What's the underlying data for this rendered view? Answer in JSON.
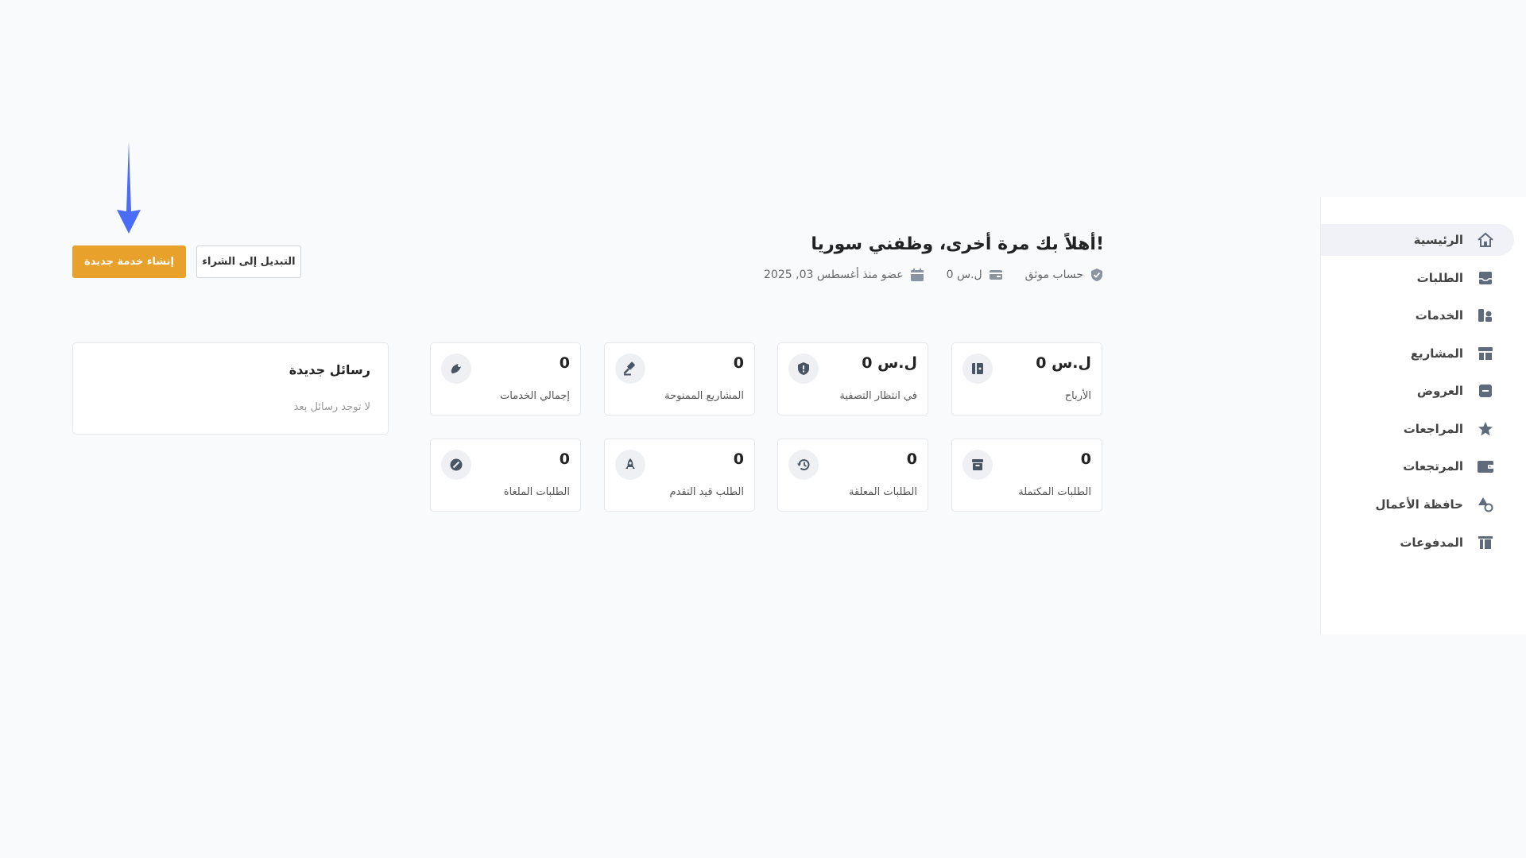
{
  "colors": {
    "accent": "#e8a22b",
    "arrow": "#4a6cf7",
    "page_background": "#f9fafc",
    "icon_gray": "#5f6b7a"
  },
  "sidebar": {
    "items": [
      {
        "label": "الرئيسية",
        "icon": "home-icon",
        "active": true
      },
      {
        "label": "الطلبات",
        "icon": "inbox-icon",
        "active": false
      },
      {
        "label": "الخدمات",
        "icon": "services-icon",
        "active": false
      },
      {
        "label": "المشاريع",
        "icon": "projects-icon",
        "active": false
      },
      {
        "label": "العروض",
        "icon": "offers-icon",
        "active": false
      },
      {
        "label": "المراجعات",
        "icon": "star-icon",
        "active": false
      },
      {
        "label": "المرتجعات",
        "icon": "wallet-icon",
        "active": false
      },
      {
        "label": "حافظة الأعمال",
        "icon": "shapes-icon",
        "active": false
      },
      {
        "label": "المدفوعات",
        "icon": "payments-icon",
        "active": false
      }
    ]
  },
  "header": {
    "welcome": "أهلاً بك مرة أخرى، وظفني سوريا!",
    "meta": {
      "verified": "حساب موثق",
      "balance": "0 ل.س",
      "member_since": "عضو منذ أغسطس 03, 2025"
    }
  },
  "actions": {
    "create_service": "إنشاء خدمة جديدة",
    "switch_to_buying": "التبديل إلى الشراء"
  },
  "stats": [
    {
      "value": "0 ل.س",
      "label": "الأرباح",
      "icon": "earnings-icon"
    },
    {
      "value": "0 ل.س",
      "label": "في انتظار التصفية",
      "icon": "shield-icon"
    },
    {
      "value": "0",
      "label": "المشاريع الممنوحة",
      "icon": "gavel-icon"
    },
    {
      "value": "0",
      "label": "إجمالي الخدمات",
      "icon": "services-total-icon"
    },
    {
      "value": "0",
      "label": "الطلبات المكتملة",
      "icon": "archive-icon"
    },
    {
      "value": "0",
      "label": "الطلبات المعلقة",
      "icon": "history-icon"
    },
    {
      "value": "0",
      "label": "الطلب قيد التقدم",
      "icon": "rocket-icon"
    },
    {
      "value": "0",
      "label": "الطلبات الملغاة",
      "icon": "cancel-icon"
    }
  ],
  "messages": {
    "title": "رسائل جديدة",
    "empty": "لا توجد رسائل بعد"
  }
}
